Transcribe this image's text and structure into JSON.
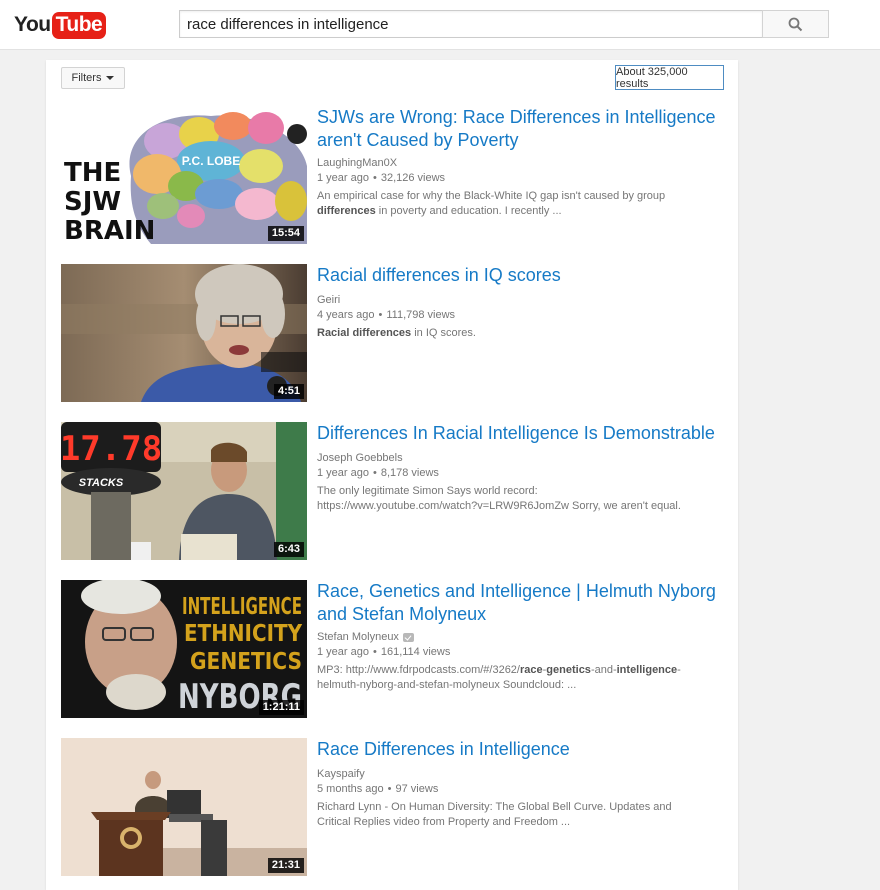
{
  "brand": {
    "you": "You",
    "tube": "Tube"
  },
  "search": {
    "query": "race differences in intelligence"
  },
  "toolbar": {
    "filters_label": "Filters",
    "results_count": "About 325,000 results"
  },
  "results": [
    {
      "title_line1": "SJWs are Wrong: Race Differences in Intelligence",
      "title_line2": "aren't Caused by Poverty",
      "channel": "LaughingMan0X",
      "age": "1 year ago",
      "views": "32,126 views",
      "desc_line1": "An empirical case for why the Black-White IQ gap isn't caused by group",
      "desc_bold": "differences",
      "desc_line2_rest": " in poverty and education. I recently ...",
      "duration": "15:54",
      "thumb_text": {
        "l1": "THE",
        "l2": "SJW",
        "l3": "BRAIN",
        "lobe": "P.C. LOBE"
      }
    },
    {
      "title_line1": "Racial differences in IQ scores",
      "channel": "Geiri",
      "age": "4 years ago",
      "views": "111,798 views",
      "desc_bold": "Racial differences",
      "desc_rest": " in IQ scores.",
      "duration": "4:51"
    },
    {
      "title_line1": "Differences In Racial Intelligence Is Demonstrable",
      "channel": "Joseph Goebbels",
      "age": "1 year ago",
      "views": "8,178 views",
      "desc_line1": "The only legitimate Simon Says world record:",
      "desc_line2": "https://www.youtube.com/watch?v=LRW9R6JomZw Sorry, we aren't equal.",
      "duration": "6:43",
      "thumb_text": {
        "timer": "17.78",
        "stack": "STACKS"
      }
    },
    {
      "title_line1": "Race, Genetics and Intelligence | Helmuth Nyborg",
      "title_line2": "and Stefan Molyneux",
      "channel": "Stefan Molyneux",
      "age": "1 year ago",
      "views": "161,114 views",
      "desc_a": "MP3: http://www.fdrpodcasts.com/#/3262/",
      "desc_b1": "race",
      "desc_c": "-",
      "desc_b2": "genetics",
      "desc_d": "-and-",
      "desc_b3": "intelligence",
      "desc_e": "-",
      "desc_line2": "helmuth-nyborg-and-stefan-molyneux Soundcloud: ...",
      "duration": "1:21:11",
      "thumb_text": {
        "w1": "INTELLIGENCE",
        "w2": "ETHNICITY",
        "w3": "GENETICS",
        "w4": "NYBORG"
      }
    },
    {
      "title_line1": "Race Differences in Intelligence",
      "channel": "Kayspaify",
      "age": "5 months ago",
      "views": "97 views",
      "desc_line1": "Richard Lynn - On Human Diversity: The Global Bell Curve. Updates and",
      "desc_line2": "Critical Replies video from Property and Freedom ...",
      "duration": "21:31"
    }
  ]
}
